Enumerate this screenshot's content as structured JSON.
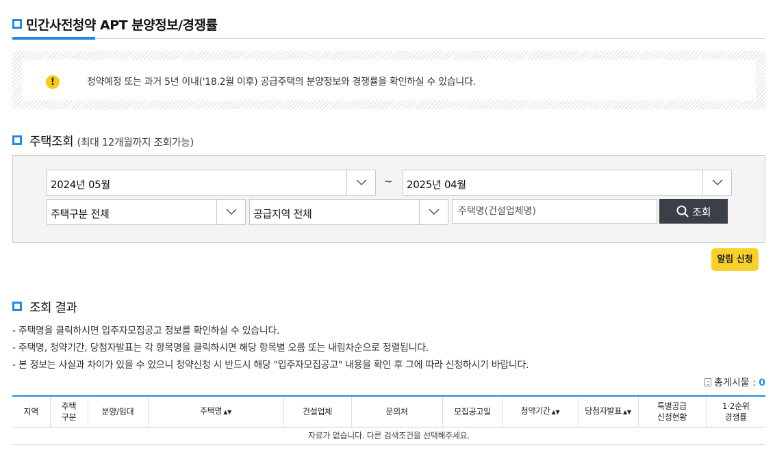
{
  "page": {
    "title": "민간사전청약 APT 분양정보/경쟁률"
  },
  "notice": {
    "icon": "warning-icon",
    "text": "청약예정 또는 과거 5년 이내('18.2월 이후) 공급주택의 분양정보와 경쟁률을 확인하실 수 있습니다."
  },
  "search": {
    "title": "주택조회",
    "subtitle": "(최대 12개월까지 조회가능)",
    "start_month": "2024년 05월",
    "separator": "~",
    "end_month": "2025년 04월",
    "house_type": "주택구분 전체",
    "region": "공급지역 전체",
    "name_placeholder": "주택명(건설업체명)",
    "button_label": "조회",
    "alarm_label": "알림 신청"
  },
  "results": {
    "title": "조회 결과",
    "guides": [
      "-  주택명을 클릭하시면 입주자모집공고 정보를 확인하실 수 있습니다.",
      "-  주택명, 청약기간, 당첨자발표는 각 항목명을 클릭하시면 해당 항목별 오름 또는 내림차순으로 정렬됩니다.",
      "-  본 정보는 사실과 차이가 있을 수 있으니 청약신청 시 반드시 해당 \"입주자모집공고\" 내용을 확인 후 그에 따라 신청하시기 바랍니다."
    ],
    "total_label": "총게시물 :",
    "total_count": "0",
    "columns": {
      "region": "지역",
      "house_type_1": "주택",
      "house_type_2": "구분",
      "sale_type": "분양/임대",
      "house_name": "주택명",
      "builder": "건설업체",
      "contact": "문의처",
      "announce_date": "모집공고일",
      "apply_period": "청약기간",
      "winner_date": "당첨자발표",
      "special_1": "특별공급",
      "special_2": "신청현황",
      "competition_1": "1·2순위",
      "competition_2": "경쟁률"
    },
    "empty_message": "자료가 없습니다. 다른 검색조건을 선택해주세요."
  },
  "colors": {
    "accent": "#1e88e5",
    "warning": "#f4cc15",
    "alarm_button": "#f7d02a",
    "search_button": "#3b3f48"
  }
}
